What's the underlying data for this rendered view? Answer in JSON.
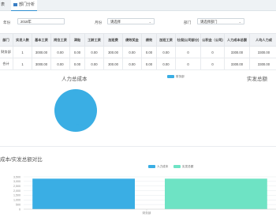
{
  "tabs": [
    {
      "label": "表"
    },
    {
      "label": "部门分析"
    }
  ],
  "filters": {
    "year": {
      "label": "年份",
      "value": "2018年"
    },
    "month": {
      "label": "月份",
      "value": "请选择"
    },
    "dept": {
      "label": "部门",
      "value": "请选择部门"
    }
  },
  "table": {
    "headers": [
      "部门",
      "实发人数",
      "基本工资",
      "岗位工资",
      "津贴",
      "工龄工资",
      "加班费",
      "绩效奖金",
      "绩效",
      "加班工资",
      "社保(公司部分)",
      "公积金（公司)",
      "人力成本总额",
      "人均人力成"
    ],
    "rows": [
      [
        "财务部",
        "1",
        "3000.00",
        "0.00",
        "0.00",
        "0.00",
        "300.00",
        "0.00",
        "0.00",
        "0.00",
        "0",
        "0",
        "3300.00",
        "3300.00"
      ],
      [
        "合计",
        "1",
        "3000.00",
        "0.00",
        "0.00",
        "0.00",
        "300.00",
        "0.00",
        "0.00",
        "0.00",
        "0",
        "0",
        "3300.00",
        "3300.00"
      ]
    ]
  },
  "pie_left": {
    "title": "人力总成本",
    "legend": "财务部",
    "slice_label": "财务部",
    "color": "#3aaee4"
  },
  "pie_right": {
    "title": "实发总额"
  },
  "bar_panel": {
    "title": "成本/实发总额对比"
  },
  "chart_data": {
    "type": "bar",
    "categories": [
      "财务部"
    ],
    "series": [
      {
        "name": "人力成本",
        "values": [
          3300
        ],
        "color": "#3aaee4"
      },
      {
        "name": "实发总额",
        "values": [
          3300
        ],
        "color": "#6ee3c4"
      }
    ],
    "yticks": [
      "0",
      "500",
      "1,000",
      "1,500",
      "2,000",
      "2,500",
      "3,000",
      "3,500"
    ],
    "ylim": [
      0,
      3500
    ],
    "grid": true,
    "legend_position": "top-right"
  }
}
